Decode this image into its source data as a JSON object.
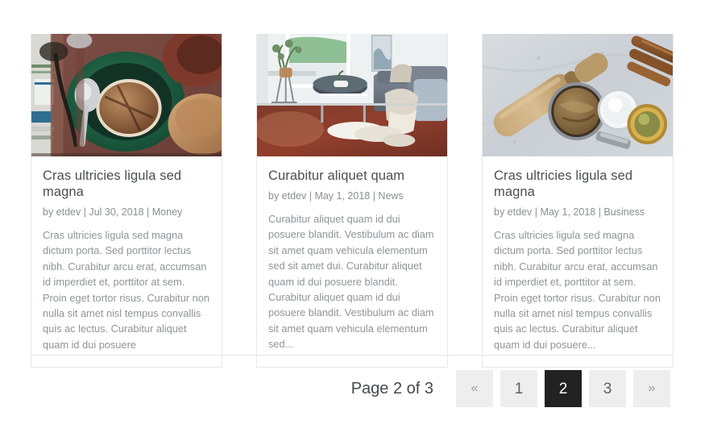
{
  "posts": [
    {
      "image_name": "food-green-pot-photo",
      "image_alt": "Green casserole pot with spoon and bread on wooden table",
      "title": "Cras ultricies ligula sed magna",
      "meta": "by etdev | Jul 30, 2018 | Money",
      "author": "etdev",
      "date": "Jul 30, 2018",
      "category": "Money",
      "excerpt": "Cras ultricies ligula sed magna dictum porta. Sed porttitor lectus nibh. Curabitur arcu erat, accumsan id imperdiet et, porttitor at sem. Proin eget tortor risus. Curabitur non nulla sit amet nisl tempus convallis quis ac lectus. Curabitur aliquet quam id dui posuere"
    },
    {
      "image_name": "living-room-interior-photo",
      "image_alt": "Living room with sofa, coffee table and wood floor",
      "title": "Curabitur aliquet quam",
      "meta": "by etdev | May 1, 2018 | News",
      "author": "etdev",
      "date": "May 1, 2018",
      "category": "News",
      "excerpt": "Curabitur aliquet quam id dui posuere blandit. Vestibulum ac diam sit amet quam vehicula elementum sed sit amet dui. Curabitur aliquet quam id dui posuere blandit. Curabitur aliquet quam id dui posuere blandit. Vestibulum ac diam sit amet quam vehicula elementum sed..."
    },
    {
      "image_name": "baking-ingredients-photo",
      "image_alt": "Rolling pin, brown sugar in measuring cup, cinnamon sticks",
      "title": "Cras ultricies ligula sed magna",
      "meta": "by etdev | May 1, 2018 | Business",
      "author": "etdev",
      "date": "May 1, 2018",
      "category": "Business",
      "excerpt": "Cras ultricies ligula sed magna dictum porta. Sed porttitor lectus nibh. Curabitur arcu erat, accumsan id imperdiet et, porttitor at sem. Proin eget tortor risus. Curabitur non nulla sit amet nisl tempus convallis quis ac lectus. Curabitur aliquet quam id dui posuere..."
    }
  ],
  "pagination": {
    "label": "Page 2 of 3",
    "current_page": 2,
    "total_pages": 3,
    "items": [
      {
        "key": "prev",
        "label": "«",
        "type": "arrow",
        "active": false
      },
      {
        "key": "1",
        "label": "1",
        "type": "number",
        "active": false
      },
      {
        "key": "2",
        "label": "2",
        "type": "number",
        "active": true
      },
      {
        "key": "3",
        "label": "3",
        "type": "number",
        "active": false
      },
      {
        "key": "next",
        "label": "»",
        "type": "arrow",
        "active": false
      }
    ]
  },
  "colors": {
    "active_page_bg": "#222222",
    "page_bg": "#eeeeee",
    "title_text": "#4a4f54",
    "body_text": "#8f949a",
    "meta_text": "#8a8f94",
    "card_border": "#e8e8e8",
    "divider": "#e6e6e6"
  }
}
